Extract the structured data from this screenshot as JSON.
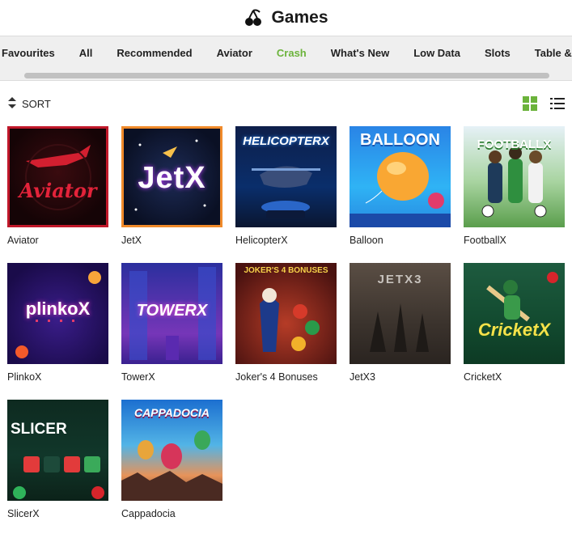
{
  "header": {
    "title": "Games",
    "logo_icon": "cherries-icon"
  },
  "tabs": [
    {
      "label": "Favourites",
      "active": false
    },
    {
      "label": "All",
      "active": false
    },
    {
      "label": "Recommended",
      "active": false
    },
    {
      "label": "Aviator",
      "active": false
    },
    {
      "label": "Crash",
      "active": true
    },
    {
      "label": "What's New",
      "active": false
    },
    {
      "label": "Low Data",
      "active": false
    },
    {
      "label": "Slots",
      "active": false
    },
    {
      "label": "Table & Ca",
      "active": false
    }
  ],
  "toolbar": {
    "sort_label": "SORT",
    "sort_icon": "sort-arrows-icon",
    "grid_view_icon": "grid-view-icon",
    "list_view_icon": "list-view-icon"
  },
  "colors": {
    "accent": "#6bb33b",
    "tabbar_bg": "#efefef"
  },
  "games": [
    {
      "name": "Aviator",
      "art": "Aviator"
    },
    {
      "name": "JetX",
      "art": "JetX"
    },
    {
      "name": "HelicopterX",
      "art": "HELICOPTERX"
    },
    {
      "name": "Balloon",
      "art": "BALLOON"
    },
    {
      "name": "FootballX",
      "art": "FOOTBALLX"
    },
    {
      "name": "PlinkoX",
      "art": "plinkoX"
    },
    {
      "name": "TowerX",
      "art": "TOWERX"
    },
    {
      "name": "Joker's 4 Bonuses",
      "art": "JOKER'S 4 BONUSES"
    },
    {
      "name": "JetX3",
      "art": "JETX3"
    },
    {
      "name": "CricketX",
      "art": "CricketX"
    },
    {
      "name": "SlicerX",
      "art": "SLICER"
    },
    {
      "name": "Cappadocia",
      "art": "CAPPADOCIA"
    }
  ]
}
